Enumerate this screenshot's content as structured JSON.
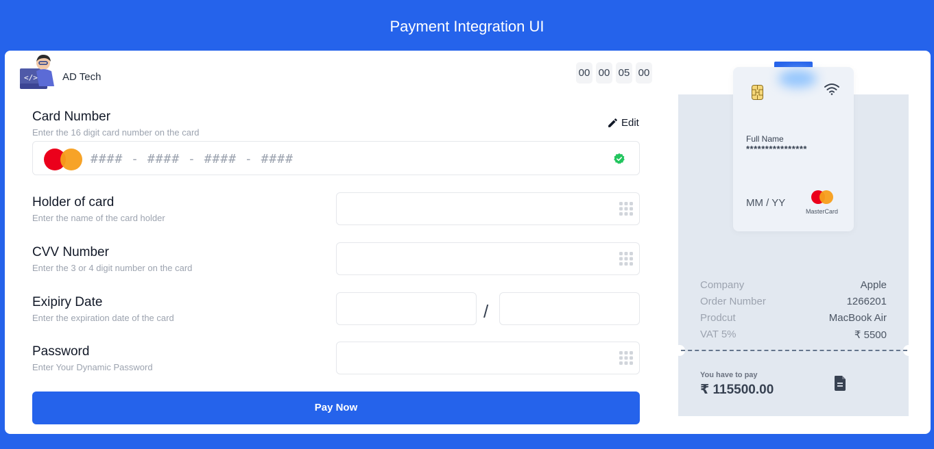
{
  "header": {
    "title": "Payment Integration UI"
  },
  "brand": {
    "name": "AD Tech"
  },
  "timer": {
    "digits": [
      "00",
      "00",
      "05",
      "00"
    ]
  },
  "card_number": {
    "title": "Card Number",
    "subtitle": "Enter the 16 digit card number on the card",
    "edit_label": "Edit",
    "placeholder": "####  -  ####  -  ####  -  ####"
  },
  "holder": {
    "title": "Holder of card",
    "subtitle": "Enter the name of the card holder",
    "value": ""
  },
  "cvv": {
    "title": "CVV Number",
    "subtitle": "Enter the 3 or 4 digit number on the card",
    "value": ""
  },
  "expiry": {
    "title": "Exipiry Date",
    "subtitle": "Enter the expiration date of the card",
    "separator": "/",
    "month": "",
    "year": ""
  },
  "password": {
    "title": "Password",
    "subtitle": "Enter Your Dynamic Password",
    "value": ""
  },
  "pay_button": {
    "label": "Pay Now"
  },
  "preview_card": {
    "name_label": "Full Name",
    "name_value": "****************",
    "expiry_value": "MM / YY",
    "brand_label": "MasterCard"
  },
  "order": {
    "rows": [
      {
        "key": "Company",
        "value": "Apple"
      },
      {
        "key": "Order Number",
        "value": "1266201"
      },
      {
        "key": "Prodcut",
        "value": "MacBook Air"
      },
      {
        "key": "VAT 5%",
        "value": "₹ 5500"
      }
    ],
    "total_label": "You have to pay",
    "total_value": "₹ 115500.00"
  },
  "colors": {
    "primary": "#2563eb",
    "success": "#22c55e",
    "mastercard_red": "#eb001b",
    "mastercard_orange": "#f79e1b"
  },
  "icons": {
    "edit": "pencil-icon",
    "verified": "check-circle-icon",
    "keypad": "keypad-icon",
    "chip": "card-chip-icon",
    "contactless": "wifi-icon",
    "receipt": "document-icon"
  }
}
